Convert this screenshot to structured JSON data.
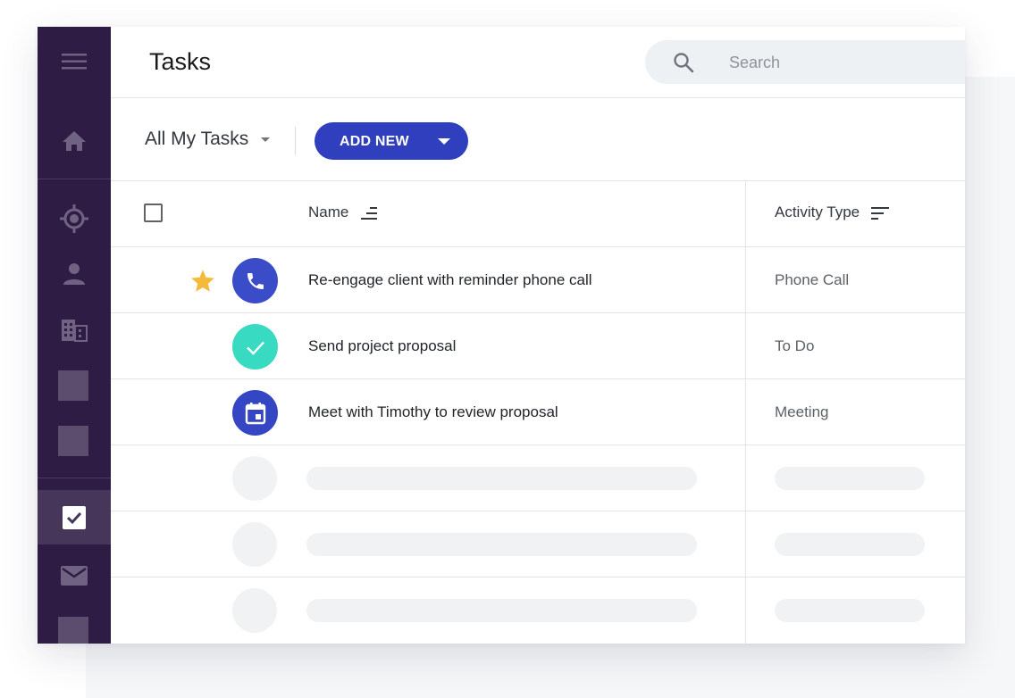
{
  "header": {
    "title": "Tasks",
    "search_placeholder": "Search"
  },
  "sidebar": {
    "items": [
      {
        "icon": "menu-icon"
      },
      {
        "icon": "home-icon"
      },
      {
        "icon": "target-icon"
      },
      {
        "icon": "person-icon"
      },
      {
        "icon": "building-icon"
      },
      {
        "icon": "placeholder"
      },
      {
        "icon": "placeholder"
      },
      {
        "icon": "tasks-checkbox-icon",
        "active": true
      },
      {
        "icon": "mail-icon"
      },
      {
        "icon": "placeholder"
      }
    ]
  },
  "toolbar": {
    "filter_label": "All My Tasks",
    "add_new_label": "ADD NEW"
  },
  "table": {
    "columns": {
      "name": "Name",
      "activity_type": "Activity Type"
    },
    "rows": [
      {
        "name": "Re-engage client with reminder phone call",
        "type": "Phone Call",
        "starred": true,
        "icon": "phone-icon"
      },
      {
        "name": "Send project proposal",
        "type": "To Do",
        "starred": false,
        "icon": "check-icon"
      },
      {
        "name": "Meet with Timothy to review proposal",
        "type": "Meeting",
        "starred": false,
        "icon": "calendar-icon"
      }
    ]
  },
  "colors": {
    "sidebar": "#2e1c45",
    "accent": "#2f3fbd",
    "phone_avatar": "#3b4cc8",
    "todo_avatar": "#38dbc2",
    "meeting_avatar": "#3446c4",
    "star": "#f5b93b"
  }
}
